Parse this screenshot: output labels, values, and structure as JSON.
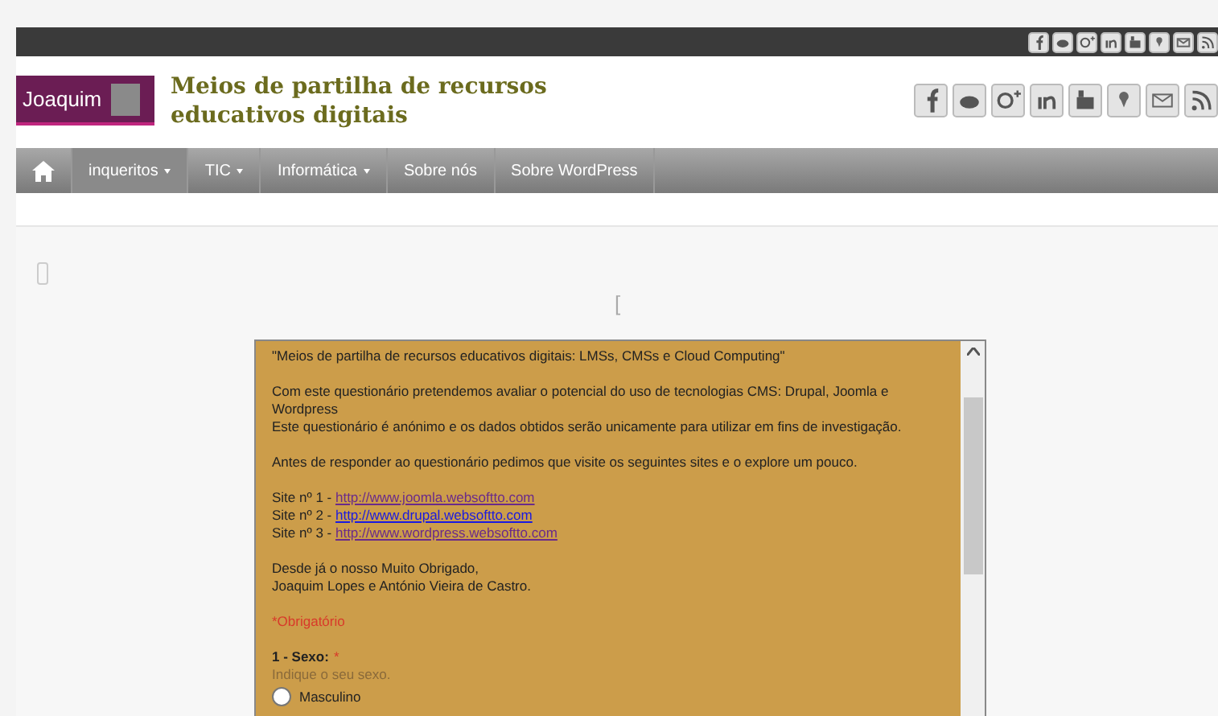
{
  "top_bar": {
    "social_icons": [
      {
        "kind": "facebook"
      },
      {
        "kind": "twitter"
      },
      {
        "kind": "googleplus"
      },
      {
        "kind": "linkedin"
      },
      {
        "kind": "youtube"
      },
      {
        "kind": "maps"
      },
      {
        "kind": "mail"
      },
      {
        "kind": "rss"
      }
    ]
  },
  "header": {
    "logo_text": "Joaquim",
    "site_title": "Meios de partilha de recursos educativos digitais",
    "social_icons": [
      {
        "kind": "facebook"
      },
      {
        "kind": "twitter"
      },
      {
        "kind": "googleplus"
      },
      {
        "kind": "linkedin"
      },
      {
        "kind": "youtube"
      },
      {
        "kind": "maps"
      },
      {
        "kind": "mail"
      },
      {
        "kind": "rss"
      }
    ]
  },
  "nav": {
    "items": [
      {
        "label": "inqueritos",
        "dropdown": true,
        "selected": true
      },
      {
        "label": "TIC",
        "dropdown": true,
        "selected": false
      },
      {
        "label": "Informática",
        "dropdown": true,
        "selected": false
      },
      {
        "label": "Sobre nós",
        "dropdown": false,
        "selected": false
      },
      {
        "label": "Sobre WordPress",
        "dropdown": false,
        "selected": false
      }
    ]
  },
  "content": {
    "bracket": "[",
    "form": {
      "paragraphs": [
        {
          "lines": [
            "\"Meios de partilha de recursos educativos digitais: LMSs, CMSs e Cloud Computing\""
          ]
        },
        {
          "lines": [
            "Com este questionário pretendemos avaliar o potencial do uso de tecnologias CMS: Drupal, Joomla e Wordpress",
            "Este questionário é anónimo e os dados obtidos serão unicamente para utilizar em fins de investigação."
          ]
        },
        {
          "lines": [
            "Antes de responder ao questionário pedimos que visite os seguintes sites e o explore um pouco."
          ]
        },
        {
          "sites": [
            {
              "label": "Site nº 1 - ",
              "url": "http://www.joomla.websoftto.com",
              "visited": true
            },
            {
              "label": "Site nº 2 - ",
              "url": "http://www.drupal.websoftto.com",
              "visited": false
            },
            {
              "label": "Site nº 3 - ",
              "url": "http://www.wordpress.websoftto.com",
              "visited": true
            }
          ]
        },
        {
          "lines": [
            "Desde já o nosso Muito Obrigado,",
            "Joaquim Lopes e António Vieira de Castro."
          ]
        }
      ],
      "required_note": "*Obrigatório",
      "question": {
        "title": "1 - Sexo:",
        "required_mark": "*",
        "help": "Indique o seu sexo.",
        "options": [
          {
            "label": "Masculino",
            "selected": false
          }
        ]
      }
    }
  }
}
